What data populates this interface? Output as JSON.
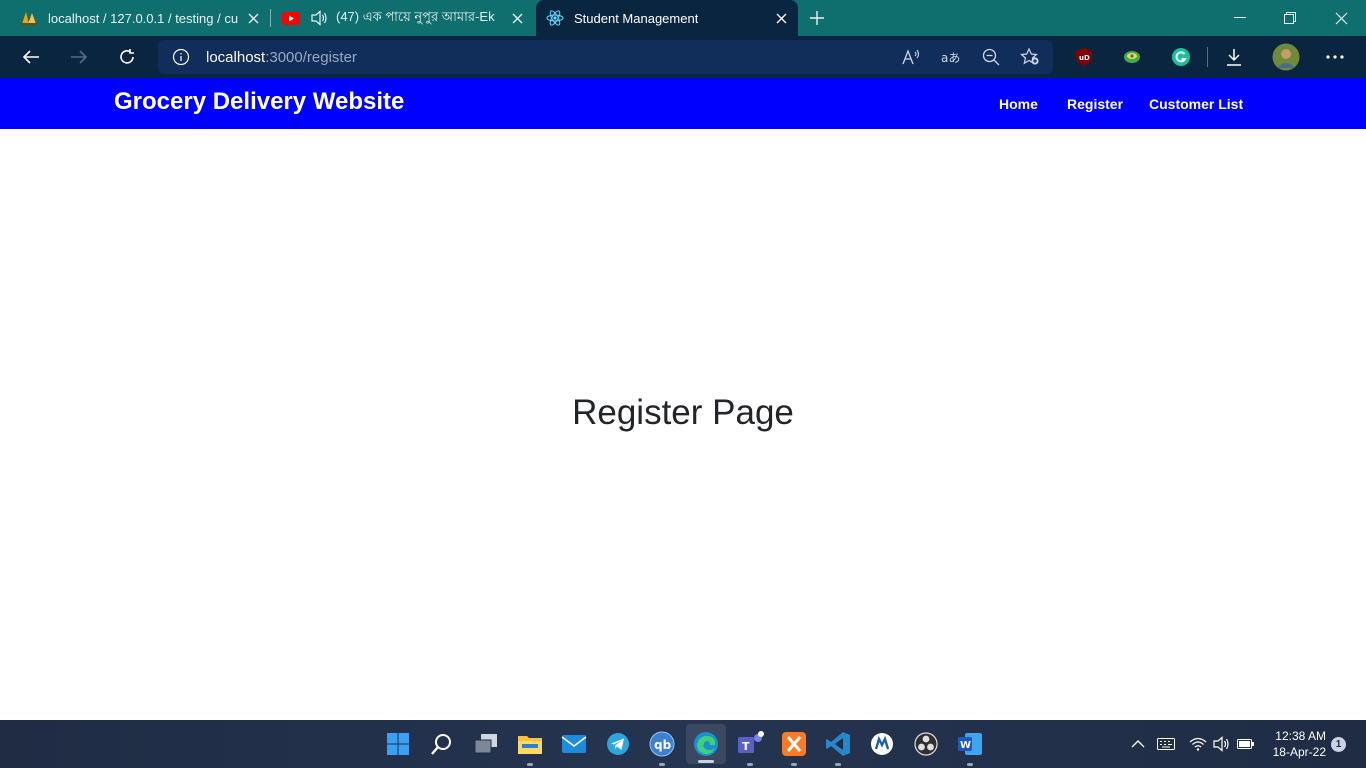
{
  "browser": {
    "tabs": [
      {
        "title": "localhost / 127.0.0.1 / testing / cu",
        "icon": "phpmyadmin-icon"
      },
      {
        "title": "(47) এক পায়ে নুপুর আমার-Ek",
        "icon": "youtube-icon",
        "audio_icon": "speaker-icon"
      },
      {
        "title": "Student Management",
        "icon": "react-icon"
      }
    ],
    "url_host": "localhost",
    "url_rest": ":3000/register"
  },
  "page": {
    "brand": "Grocery Delivery Website",
    "nav": [
      {
        "label": "Home"
      },
      {
        "label": "Register"
      },
      {
        "label": "Customer List"
      }
    ],
    "heading": "Register Page",
    "colors": {
      "navbar": "#0000ff",
      "heading": "#212529"
    }
  },
  "taskbar": {
    "apps": [
      "windows-start-icon",
      "search-icon",
      "task-view-icon",
      "file-explorer-icon",
      "mail-icon",
      "telegram-icon",
      "qbittorrent-icon",
      "edge-icon",
      "teams-icon",
      "xampp-icon",
      "vscode-icon",
      "app-icon",
      "obs-icon",
      "word-icon"
    ],
    "time": "12:38 AM",
    "date": "18-Apr-22",
    "notifications": "1"
  }
}
